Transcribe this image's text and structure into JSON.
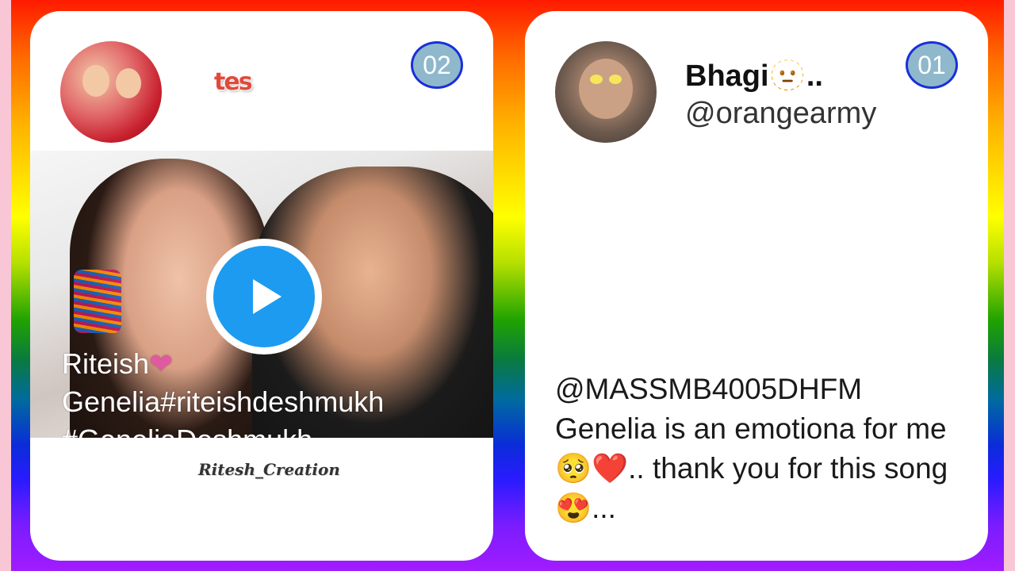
{
  "left_card": {
    "counter": "02",
    "sticker_text": "tes",
    "caption_line1": "Riteish",
    "caption_heart": "❤",
    "caption_line2": "Genelia#riteishdeshmukh",
    "caption_line3": "#GeneliaDeshmukh",
    "watermark": "Ritesh_Creation"
  },
  "right_card": {
    "counter": "01",
    "display_name": "Bhagi🫥..",
    "handle": "@orangearmy",
    "tweet_text": "@MASSMB4005DHFM Genelia is an emotiona for me 🥺❤️.. thank you for this song 😍..."
  },
  "colors": {
    "play_button": "#1d9bf0",
    "badge_fill": "#8fb8cc",
    "badge_border": "#1a2fd8",
    "side_strip": "#f8c6d4"
  },
  "icons": {
    "play": "play-icon"
  }
}
